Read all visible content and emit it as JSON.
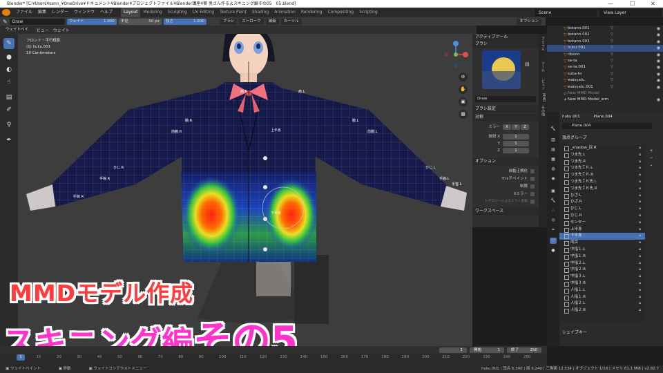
{
  "titlebar": {
    "text": "Blender* [C:¥Users¥sann_¥OneDrive¥ドキュメント¥Blender¥プロジェクトファイル¥Blender講座¥葵 兎さん作るよスキニング編その05　05.blend]",
    "minimize": "—",
    "maximize": "☐",
    "close": "✕"
  },
  "menubar": {
    "menus": [
      "ファイル",
      "編集",
      "レンダー",
      "ウィンドウ",
      "ヘルプ"
    ],
    "workspaces": [
      "Layout",
      "Modeling",
      "Sculpting",
      "UV Editing",
      "Texture Paint",
      "Shading",
      "Animation",
      "Rendering",
      "Compositing",
      "Scripting"
    ],
    "active_workspace": "Layout",
    "scene": "Scene",
    "view_layer": "View Layer"
  },
  "toolheader": {
    "brush": "Draw",
    "weight_label": "ウェイト",
    "weight_value": "1.000",
    "radius_label": "半径",
    "radius_value": "50 px",
    "strength_label": "強さ",
    "strength_value": "1.000",
    "menus": [
      "ブラシ",
      "ストローク",
      "減衰",
      "カーソル"
    ],
    "options": "オプション"
  },
  "modeheader": {
    "mode": "ウェイトペイ.",
    "items": [
      "ビュー",
      "ウェイト"
    ]
  },
  "viewport": {
    "view_name": "フロント・平行投影",
    "object": "(1) huku.001",
    "scale": "10 Centimeters",
    "bone_labels": [
      "肩.R",
      "肩.L",
      "腕.R",
      "腕.L",
      "前腕.R",
      "前腕.L",
      "ひじ.R",
      "ひじ.L",
      "手捩.R",
      "手捩.L",
      "手首.R",
      "手首.L",
      "上半身",
      "下半身"
    ]
  },
  "npanel": {
    "active_tool": "アクティブツール",
    "brush_section": "ブラシ",
    "brush_name": "Draw",
    "brush_settings": "ブラシ設定",
    "symmetry": "対称",
    "mirror_label": "ミラー",
    "axes": [
      "X",
      "Y",
      "Z"
    ],
    "radial_label": "放射 X",
    "radial_values": [
      "1",
      "1",
      "1"
    ],
    "options_section": "オプション",
    "opt_items": [
      "自動正規化",
      "マルチペイント",
      "制限",
      "Xミラー",
      "トポロジーによるミラー反転"
    ],
    "workspace": "ワークスペース",
    "tabs": [
      "アイテム",
      "ツール",
      "ビュー",
      "MMD",
      "その他"
    ]
  },
  "outliner": {
    "rows": [
      {
        "name": "botann.001"
      },
      {
        "name": "botann.002"
      },
      {
        "name": "botann.003"
      },
      {
        "name": "huku.001",
        "selected": true
      },
      {
        "name": "ribonn"
      },
      {
        "name": "se-ta"
      },
      {
        "name": "se-ta.001"
      },
      {
        "name": "suka-to"
      },
      {
        "name": "waisyatu"
      },
      {
        "name": "waisyatu.001"
      },
      {
        "name": "New MMD Model"
      },
      {
        "name": "New MMD Model_arm"
      }
    ]
  },
  "properties": {
    "object": "huku.001",
    "mesh": "Plane.004",
    "mesh_field": "Plane.004",
    "vertex_groups_title": "頂点グループ",
    "vertex_groups": [
      "_shadow_目.R",
      "つま先.L",
      "つま先.R",
      "つま先ＩＫ.L",
      "つま先ＩＫ.R",
      "つま先ＩＫ先.L",
      "つま先ＩＫ先.R",
      "ひざ.L",
      "ひざ.R",
      "ひじ.L",
      "ひじ.R",
      "センター",
      "上半身",
      "下半身",
      "両目",
      "中指１.L",
      "中指１.R",
      "中指２.L",
      "中指２.R",
      "中指３.L",
      "中指３.R",
      "人指１.L",
      "人指１.R",
      "人指２.L",
      "人指２.R"
    ],
    "selected_group": "下半身",
    "shape_keys": "シェイプキー"
  },
  "timeline": {
    "current_frame": "1",
    "start_label": "開始",
    "start": "1",
    "end_label": "終了",
    "end": "250",
    "ticks": [
      "1",
      "10",
      "20",
      "30",
      "40",
      "50",
      "60",
      "70",
      "80",
      "90",
      "100",
      "110",
      "120",
      "130",
      "140",
      "150",
      "160",
      "170",
      "180",
      "190",
      "200",
      "210",
      "220",
      "230",
      "240",
      "250"
    ]
  },
  "statusbar": {
    "left": [
      "ウェイトペイント",
      "移動",
      "ウェイトコンテクストメニュー"
    ],
    "right": "huku.001 | 頂点 6,340 | 面 6,240 | 三角面 12,534 | オブジェクト 1/18 | メモリ 61.1 MiB | v2.82.7"
  },
  "overlay": {
    "line1": "MMDモデル作成",
    "line2a": "スキニング編",
    "line2b": "その5"
  },
  "colors": {
    "accent": "#4772b3",
    "blender_orange": "#e87d0d",
    "overlay_red": "#ff3c3c",
    "overlay_pink": "#ff33cc",
    "jacket": "#151a4a"
  }
}
